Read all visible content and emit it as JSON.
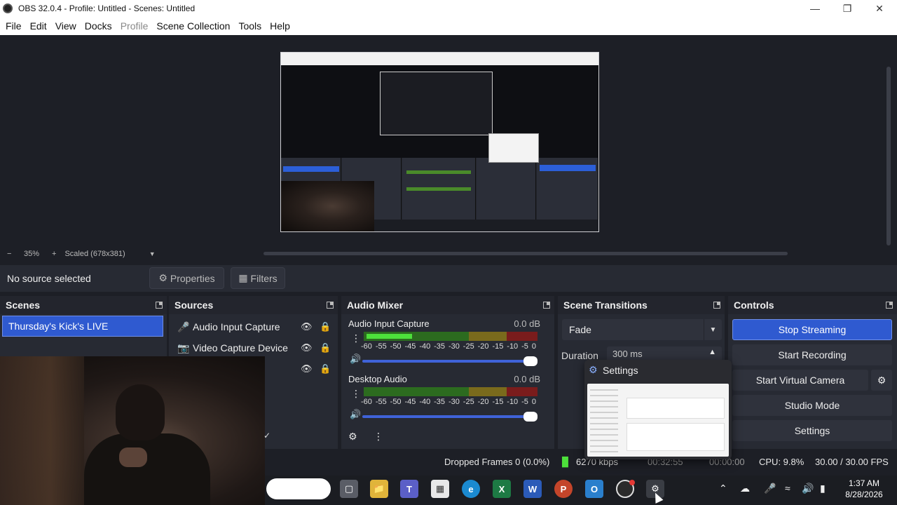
{
  "window": {
    "title": "OBS 32.0.4 - Profile: Untitled - Scenes: Untitled"
  },
  "menu": [
    "File",
    "Edit",
    "View",
    "Docks",
    "Profile",
    "Scene Collection",
    "Tools",
    "Help"
  ],
  "preview": {
    "zoom_out": "−",
    "zoom": "35%",
    "zoom_in": "+",
    "scale_mode": "Scaled (678x381)"
  },
  "source_toolbar": {
    "no_source": "No source selected",
    "properties": "Properties",
    "filters": "Filters"
  },
  "scenes": {
    "header": "Scenes",
    "items": [
      "Thursday's Kick's LIVE"
    ]
  },
  "sources": {
    "header": "Sources",
    "items": [
      {
        "name": "Audio Input Capture",
        "icon": "microphone-icon"
      },
      {
        "name": "Video Capture Device",
        "icon": "camera-icon"
      },
      {
        "name": "",
        "icon": ""
      }
    ]
  },
  "mixer": {
    "header": "Audio Mixer",
    "channels": [
      {
        "name": "Audio Input Capture",
        "db": "0.0 dB",
        "level": 0.27
      },
      {
        "name": "Desktop Audio",
        "db": "0.0 dB",
        "level": 0.0
      }
    ],
    "ticks": [
      "-60",
      "-55",
      "-50",
      "-45",
      "-40",
      "-35",
      "-30",
      "-25",
      "-20",
      "-15",
      "-10",
      "-5",
      "0"
    ]
  },
  "transitions": {
    "header": "Scene Transitions",
    "selected": "Fade",
    "duration_label": "Duration",
    "duration_value": "300 ms"
  },
  "controls": {
    "header": "Controls",
    "stop_streaming": "Stop Streaming",
    "start_recording": "Start Recording",
    "start_virtual_camera": "Start Virtual Camera",
    "studio_mode": "Studio Mode",
    "settings": "Settings"
  },
  "settings_popup": {
    "title": "Settings"
  },
  "status": {
    "dropped": "Dropped Frames 0 (0.0%)",
    "bitrate": "6270 kbps",
    "live_time": "00:32:55",
    "rec_time": "00:00:00",
    "cpu": "CPU: 9.8%",
    "fps": "30.00 / 30.00 FPS"
  },
  "clock": {
    "time": "1:37 AM",
    "date": "8/28/2026"
  },
  "colors": {
    "accent": "#2f5ad0",
    "meter_green": "#4de03b",
    "background": "#1d1f26"
  }
}
